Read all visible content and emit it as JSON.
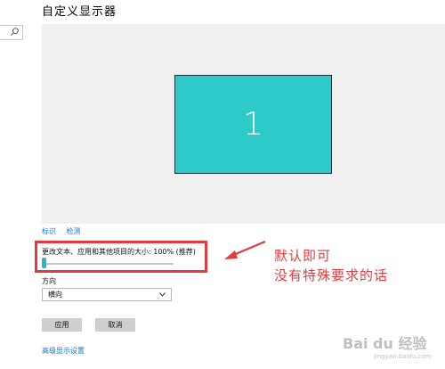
{
  "page_title": "自定义显示器",
  "monitor": {
    "number": "1",
    "color": "#2ccac9"
  },
  "links": {
    "identify": "标识",
    "detect": "检测"
  },
  "scale": {
    "label": "更改文本、应用和其他项目的大小: 100% (推荐)",
    "value_fraction": 0.0
  },
  "orientation": {
    "label": "方向",
    "value": "横向"
  },
  "buttons": {
    "apply": "应用",
    "cancel": "取消"
  },
  "advanced_link": "高级显示设置",
  "annotation": {
    "line1": "默认即可",
    "line2": "没有特殊要求的话",
    "color": "#e33b3b"
  },
  "watermark": {
    "brand": "Bai du 经验",
    "sub": "jingyan.baidu.com"
  },
  "icons": {
    "search": "search-icon",
    "chevron": "chevron-down-icon"
  }
}
